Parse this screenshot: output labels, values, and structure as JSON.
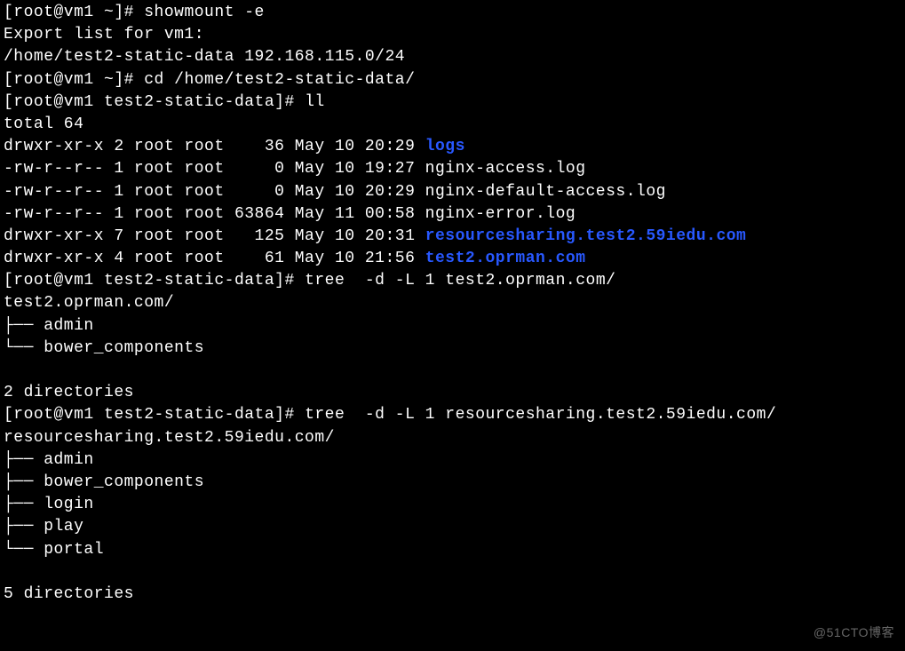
{
  "lines": {
    "l1_prompt": "[root@vm1 ~]# ",
    "l1_cmd": "showmount -e",
    "l2": "Export list for vm1:",
    "l3": "/home/test2-static-data 192.168.115.0/24",
    "l4_prompt": "[root@vm1 ~]# ",
    "l4_cmd": "cd /home/test2-static-data/",
    "l5_prompt": "[root@vm1 test2-static-data]# ",
    "l5_cmd": "ll",
    "l6": "total 64",
    "ls1_pre": "drwxr-xr-x 2 root root    36 May 10 20:29 ",
    "ls1_name": "logs",
    "ls2": "-rw-r--r-- 1 root root     0 May 10 19:27 nginx-access.log",
    "ls3": "-rw-r--r-- 1 root root     0 May 10 20:29 nginx-default-access.log",
    "ls4": "-rw-r--r-- 1 root root 63864 May 11 00:58 nginx-error.log",
    "ls5_pre": "drwxr-xr-x 7 root root   125 May 10 20:31 ",
    "ls5_name": "resourcesharing.test2.59iedu.com",
    "ls6_pre": "drwxr-xr-x 4 root root    61 May 10 21:56 ",
    "ls6_name": "test2.oprman.com",
    "l7_prompt": "[root@vm1 test2-static-data]# ",
    "l7_cmd": "tree  -d -L 1 test2.oprman.com/",
    "t1": "test2.oprman.com/",
    "t2": "├── admin",
    "t3": "└── bower_components",
    "blank": " ",
    "d1": "2 directories",
    "l8_prompt": "[root@vm1 test2-static-data]# ",
    "l8_cmd": "tree  -d -L 1 resourcesharing.test2.59iedu.com/",
    "r1": "resourcesharing.test2.59iedu.com/",
    "r2": "├── admin",
    "r3": "├── bower_components",
    "r4": "├── login",
    "r5": "├── play",
    "r6": "└── portal",
    "d2": "5 directories"
  },
  "watermark": "@51CTO博客"
}
